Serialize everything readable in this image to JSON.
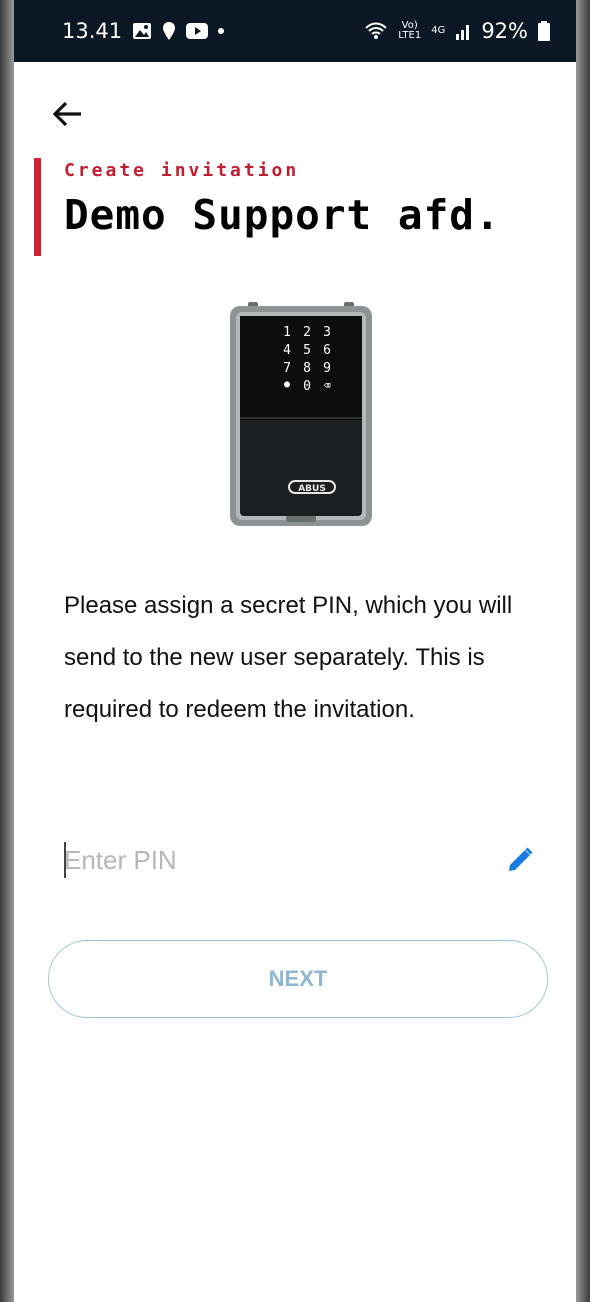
{
  "status_bar": {
    "time": "13.41",
    "network_line1": "Vo)",
    "network_line2": "LTE1",
    "network_type": "4G",
    "battery": "92%",
    "icons": [
      "gallery-icon",
      "location-icon",
      "youtube-icon",
      "wifi-calling-icon",
      "signal-icon",
      "battery-icon"
    ]
  },
  "header": {
    "subtitle": "Create invitation",
    "title": "Demo Support afd."
  },
  "device": {
    "keypad": [
      "1",
      "2",
      "3",
      "4",
      "5",
      "6",
      "7",
      "8",
      "9",
      "●",
      "0",
      "⌫"
    ],
    "brand": "ABUS"
  },
  "instructions": "Please assign a secret PIN, which you will send to the new user separately. This is required to redeem the invitation.",
  "pin": {
    "placeholder": "Enter PIN",
    "value": ""
  },
  "next_button": "NEXT",
  "colors": {
    "accent": "#d11f34",
    "status_bar_bg": "#0c1726",
    "edit_icon": "#1a7be0",
    "button_border": "#9fc4dd",
    "button_text": "#8fb6d3"
  }
}
